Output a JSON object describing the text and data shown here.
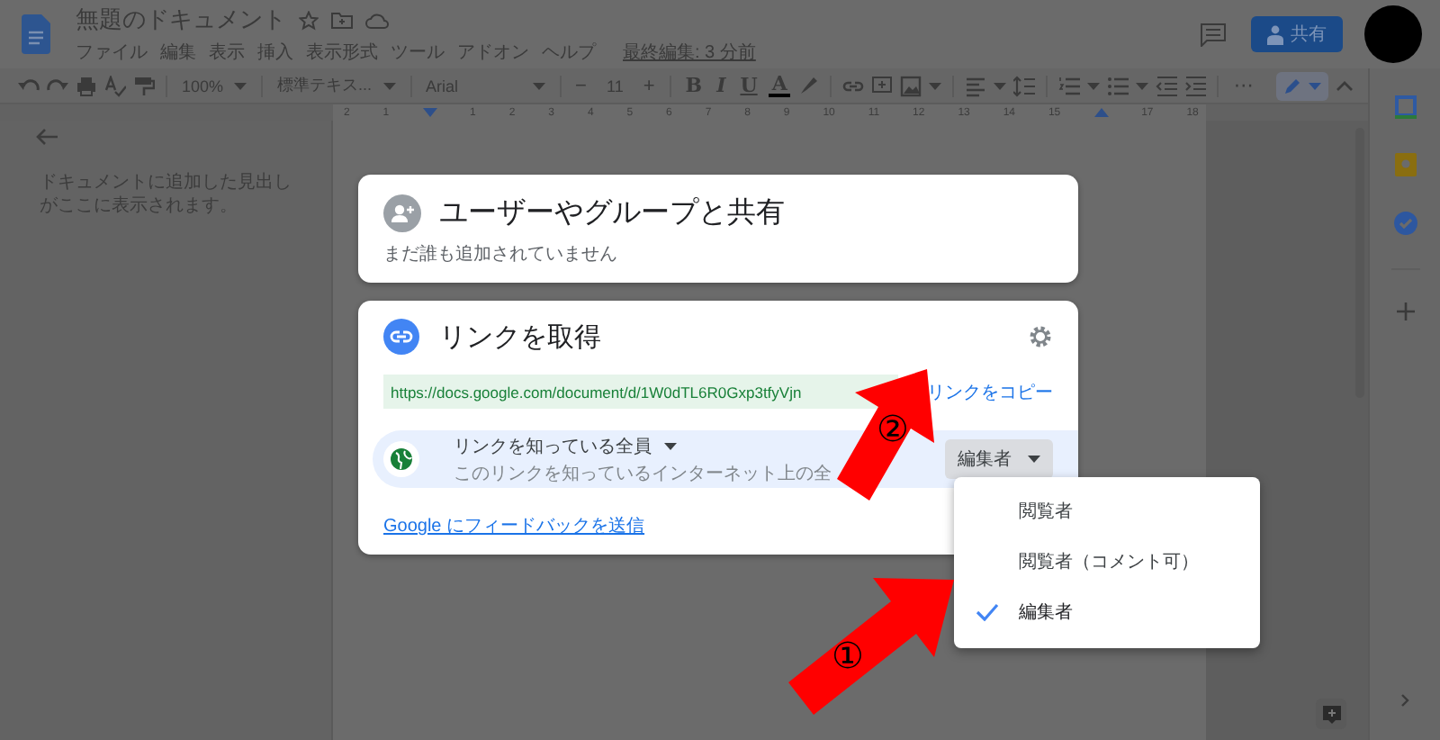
{
  "document": {
    "title": "無題のドキュメント",
    "menus": [
      "ファイル",
      "編集",
      "表示",
      "挿入",
      "表示形式",
      "ツール",
      "アドオン",
      "ヘルプ"
    ],
    "last_edit": "最終編集: 3 分前",
    "share_button": "共有"
  },
  "toolbar": {
    "zoom": "100%",
    "style": "標準テキス...",
    "font": "Arial",
    "size_minus": "−",
    "font_size": "11",
    "size_plus": "+",
    "bold": "B",
    "italic": "I",
    "underline": "U",
    "text_color": "A",
    "more": "⋯"
  },
  "ruler": [
    "2",
    "1",
    "1",
    "2",
    "3",
    "4",
    "5",
    "6",
    "7",
    "8",
    "9",
    "10",
    "11",
    "12",
    "13",
    "14",
    "15",
    "17",
    "18"
  ],
  "outline": {
    "hint": "ドキュメントに追加した見出しがここに表示されます。"
  },
  "share_panel": {
    "title": "ユーザーやグループと共有",
    "subtitle": "まだ誰も追加されていません"
  },
  "link_panel": {
    "title": "リンクを取得",
    "url": "https://docs.google.com/document/d/1W0dTL6R0Gxp3tfyVjn",
    "copy_link": "リンクをコピー",
    "access": "リンクを知っている全員",
    "access_description": "このリンクを知っているインターネット上の全",
    "role": "編集者",
    "feedback": "Google にフィードバックを送信"
  },
  "role_menu": [
    {
      "label": "閲覧者",
      "selected": false
    },
    {
      "label": "閲覧者（コメント可）",
      "selected": false
    },
    {
      "label": "編集者",
      "selected": true
    }
  ],
  "annotations": [
    {
      "label": "②"
    },
    {
      "label": "①"
    }
  ]
}
